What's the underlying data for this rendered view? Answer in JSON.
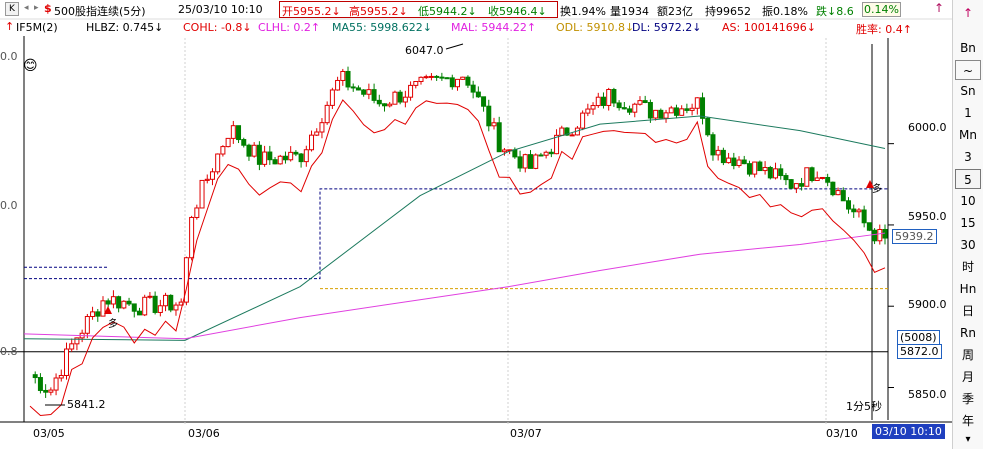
{
  "header": {
    "k_button": "K",
    "nav_left": "◂",
    "nav_right": "▸",
    "dollar": "$",
    "title": "500股指连续(5分)",
    "datetime": "25/03/10 10:10",
    "open": "开5955.2↓",
    "high": "高5955.2↓",
    "low": "低5944.2↓",
    "close": "收5946.4↓",
    "turnover": "换1.94%",
    "volume": "量1934",
    "amount": "额23亿",
    "hold": "持99652",
    "amplitude": "振0.18%",
    "change": "跌↓8.6",
    "change_pct": "0.14%"
  },
  "indicator": {
    "arrow": "↑",
    "name": "IF5M(2)",
    "hlbz": "HLBZ: 0.745↓",
    "cohl": "COHL: -0.8↓",
    "clhl": "CLHL: 0.2↑",
    "ma55": "MA55: 5998.622↓",
    "mal": "MAL: 5944.22↑",
    "odl": "ODL: 5910.8↓",
    "dl": "DL: 5972.2↓",
    "as": "AS: 100141696↓",
    "win": "胜率: 0.4↑"
  },
  "price_axis": {
    "ticks": [
      "6000.0",
      "5950.0",
      "5900.0",
      "5850.0"
    ],
    "current_price": "5939.2",
    "ref_count": "(5008)",
    "ref_price": "5872.0"
  },
  "left_axis": {
    "labels": [
      "0.0",
      "0.0",
      "0.8"
    ]
  },
  "date_axis": {
    "labels": [
      "03/05",
      "03/06",
      "03/07",
      "03/10"
    ],
    "current": "03/10 10:10"
  },
  "annotations": {
    "high_label": "6047.0",
    "low_label": "5841.2",
    "countdown": "1分5秒",
    "signal_duo": "多",
    "signal_duo2": "多"
  },
  "colors": {
    "up": "#e00000",
    "down": "#008000",
    "ma55": "#1c7a5e",
    "mal": "#e040e0",
    "dl": "#000080",
    "odl": "#d8a000",
    "dl_line": "#e00000",
    "axis": "#000000"
  },
  "rightbar": {
    "items": [
      "↑",
      "Bn",
      "~",
      "Sn",
      "1",
      "Mn",
      "3",
      "5",
      "10",
      "15",
      "30",
      "时",
      "Hn",
      "日",
      "Rn",
      "周",
      "月",
      "季",
      "年",
      "▾"
    ]
  },
  "chart_data": {
    "type": "candlestick",
    "title": "500股指连续(5分)",
    "ylim": [
      5830,
      6065
    ],
    "horizontal_levels": {
      "dl": 5972.2,
      "odl": 5910.8,
      "ref": 5872.0,
      "old_dl": 5917.0
    },
    "events": {
      "high": 6047.0,
      "low": 5841.2,
      "last": 5939.2
    },
    "seed": 7
  }
}
